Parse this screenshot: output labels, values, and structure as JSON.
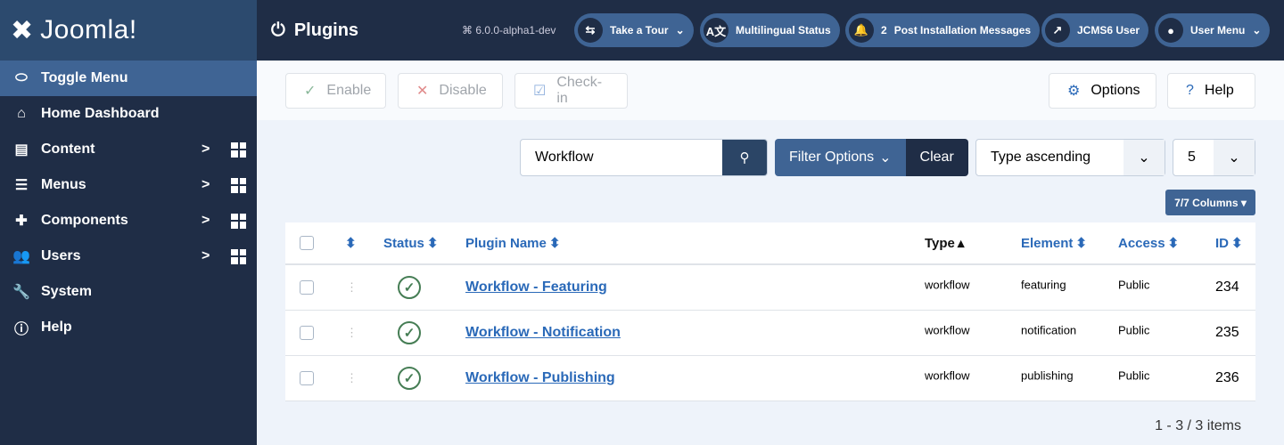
{
  "brand": {
    "logo_text": "Joomla!"
  },
  "sidebar": {
    "toggle": "Toggle Menu",
    "items": [
      {
        "label": "Home Dashboard",
        "icon": "home-icon"
      },
      {
        "label": "Content",
        "icon": "file-icon"
      },
      {
        "label": "Menus",
        "icon": "list-icon"
      },
      {
        "label": "Components",
        "icon": "puzzle-icon"
      },
      {
        "label": "Users",
        "icon": "users-icon"
      },
      {
        "label": "System",
        "icon": "wrench-icon"
      },
      {
        "label": "Help",
        "icon": "info-icon"
      }
    ]
  },
  "header": {
    "title": "Plugins",
    "version": "6.0.0-alpha1-dev",
    "take_tour": "Take a Tour",
    "multilingual": "Multilingual Status",
    "post_install_count": "2",
    "post_install": "Post Installation Messages",
    "site": "JCMS6 User",
    "user_menu": "User Menu"
  },
  "toolbar": {
    "enable": "Enable",
    "disable": "Disable",
    "checkin": "Check-in",
    "options": "Options",
    "help": "Help"
  },
  "filters": {
    "search_value": "Workflow",
    "filter_options": "Filter Options",
    "clear": "Clear",
    "ordering": "Type ascending",
    "limit": "5",
    "columns": "7/7 Columns"
  },
  "table": {
    "headers": {
      "status": "Status",
      "name": "Plugin Name",
      "type": "Type",
      "element": "Element",
      "access": "Access",
      "id": "ID"
    },
    "rows": [
      {
        "name": "Workflow - Featuring",
        "type": "workflow",
        "element": "featuring",
        "access": "Public",
        "id": "234",
        "status": "enabled"
      },
      {
        "name": "Workflow - Notification",
        "type": "workflow",
        "element": "notification",
        "access": "Public",
        "id": "235",
        "status": "enabled"
      },
      {
        "name": "Workflow - Publishing",
        "type": "workflow",
        "element": "publishing",
        "access": "Public",
        "id": "236",
        "status": "enabled"
      }
    ]
  },
  "pagination": {
    "summary": "1 - 3 / 3 items"
  },
  "colors": {
    "sidebar": "#1f2d46",
    "accent": "#3f6494",
    "link": "#2a69b8",
    "success": "#457d54"
  }
}
